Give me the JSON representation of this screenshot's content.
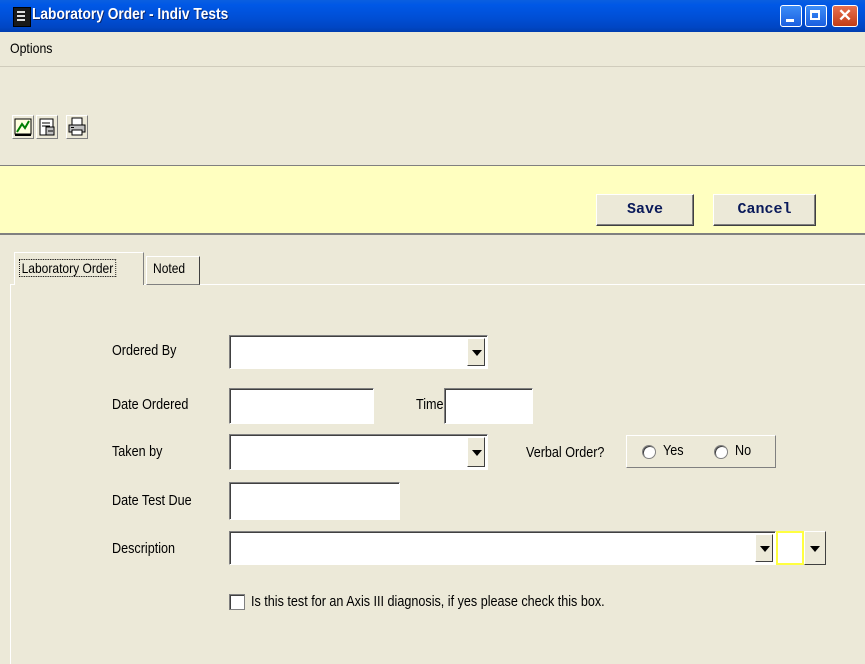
{
  "window": {
    "title": "Laboratory Order - Indiv Tests",
    "controls": [
      "minimize",
      "maximize",
      "close"
    ]
  },
  "menu": {
    "options_label": "Options"
  },
  "toolbar": {
    "icons": [
      "edit-icon",
      "properties-icon",
      "print-icon"
    ]
  },
  "commands": {
    "save_label": "Save",
    "cancel_label": "Cancel",
    "bar_color": "#ffffc0"
  },
  "tabs": [
    {
      "label": "Laboratory Order",
      "active": true
    },
    {
      "label": "Noted",
      "active": false
    }
  ],
  "form": {
    "ordered_by": {
      "label": "Ordered By",
      "value": ""
    },
    "date_ordered": {
      "label": "Date Ordered",
      "value": ""
    },
    "time": {
      "label": "Time",
      "value": ""
    },
    "taken_by": {
      "label": "Taken by",
      "value": ""
    },
    "verbal_order": {
      "label": "Verbal Order?",
      "yes_label": "Yes",
      "no_label": "No",
      "selected": ""
    },
    "date_test_due": {
      "label": "Date Test Due",
      "value": ""
    },
    "description": {
      "label": "Description",
      "value": ""
    },
    "axis_check": {
      "label": "Is this test for an Axis III diagnosis, if yes please check this box.",
      "checked": false
    }
  }
}
